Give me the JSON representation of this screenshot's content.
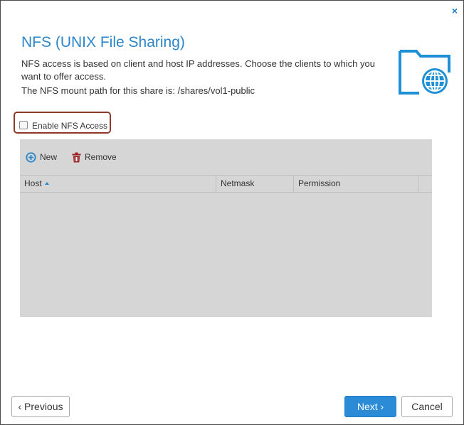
{
  "dialog": {
    "close_glyph": "×",
    "title": "NFS (UNIX File Sharing)",
    "description": "NFS access is based on client and host IP addresses. Choose the clients to which you want to offer access.",
    "mount_path_text": "The NFS mount path for this share is: /shares/vol1-public",
    "header_icon": "folder-globe-icon"
  },
  "enable_nfs": {
    "label": "Enable NFS Access",
    "checked": false
  },
  "grid": {
    "toolbar": {
      "new_label": "New",
      "remove_label": "Remove"
    },
    "columns": [
      "Host",
      "Netmask",
      "Permission"
    ],
    "sort": {
      "column": "Host",
      "direction": "ascending"
    },
    "rows": []
  },
  "footer": {
    "previous_label": "‹ Previous",
    "next_label": "Next ›",
    "cancel_label": "Cancel"
  },
  "colors": {
    "accent": "#2b86c9",
    "highlight_border": "#8e3a2b",
    "remove_icon": "#9b2222",
    "grid_background": "#d6d6d6"
  }
}
